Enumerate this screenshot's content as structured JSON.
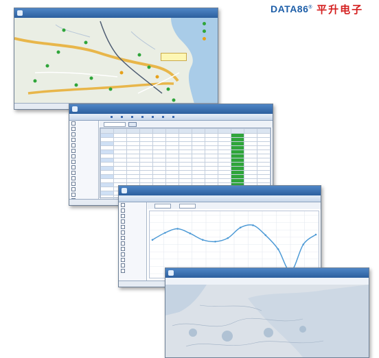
{
  "brand": {
    "latin": "DATA86",
    "reg": "®",
    "cjk": "平升电子",
    "colors": {
      "latin": "#1d5ea8",
      "cjk": "#d41e1e"
    }
  },
  "map_window": {
    "title": "",
    "info_box": "",
    "legend": [
      {
        "label": "",
        "color": "#2fa53a"
      },
      {
        "label": "",
        "color": "#2fa53a"
      },
      {
        "label": "",
        "color": "#e6a11b"
      }
    ],
    "status": [
      "",
      "",
      ""
    ]
  },
  "table_window": {
    "nav": [
      "",
      "",
      "",
      "",
      "",
      "",
      ""
    ],
    "tree": [
      "",
      "",
      "",
      "",
      "",
      "",
      "",
      "",
      "",
      "",
      "",
      "",
      "",
      "",
      "",
      ""
    ],
    "row_count": 24,
    "status": [
      "",
      "",
      ""
    ]
  },
  "chart_window": {
    "tree": [
      "",
      "",
      "",
      "",
      "",
      "",
      "",
      "",
      "",
      "",
      "",
      "",
      ""
    ],
    "toolbar": [
      "",
      "",
      ""
    ],
    "status": [
      "",
      "",
      ""
    ]
  },
  "chart_data": {
    "type": "line",
    "title": "",
    "xlabel": "",
    "ylabel": "",
    "x": [
      0,
      1,
      2,
      3,
      4,
      5,
      6,
      7,
      8,
      9,
      10,
      11,
      12,
      13
    ],
    "series": [
      {
        "values": [
          0.58,
          0.7,
          0.77,
          0.69,
          0.58,
          0.55,
          0.61,
          0.79,
          0.83,
          0.66,
          0.42,
          0.04,
          0.5,
          0.67
        ]
      }
    ],
    "ylim": [
      0,
      1
    ],
    "grid": true,
    "line_color": "#4d9ad6"
  }
}
